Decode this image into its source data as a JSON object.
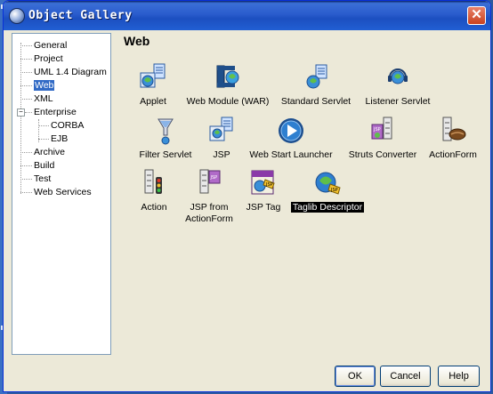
{
  "dialog": {
    "title": "Object Gallery",
    "close_symbol": "✕"
  },
  "tree": {
    "items": [
      {
        "label": "General"
      },
      {
        "label": "Project"
      },
      {
        "label": "UML 1.4 Diagram"
      },
      {
        "label": "Web",
        "selected": true
      },
      {
        "label": "XML"
      },
      {
        "label": "Enterprise",
        "expander": "−"
      },
      {
        "label": "CORBA"
      },
      {
        "label": "EJB"
      },
      {
        "label": "Archive"
      },
      {
        "label": "Build"
      },
      {
        "label": "Test"
      },
      {
        "label": "Web Services"
      }
    ]
  },
  "gallery": {
    "heading": "Web",
    "items": [
      {
        "label": "Applet",
        "icon": "applet-icon"
      },
      {
        "label": "Web Module (WAR)",
        "icon": "web-module-icon"
      },
      {
        "label": "Standard Servlet",
        "icon": "standard-servlet-icon"
      },
      {
        "label": "Listener Servlet",
        "icon": "listener-servlet-icon"
      },
      {
        "label": "Filter Servlet",
        "icon": "filter-servlet-icon"
      },
      {
        "label": "JSP",
        "icon": "jsp-icon"
      },
      {
        "label": "Web Start Launcher",
        "icon": "web-start-launcher-icon"
      },
      {
        "label": "Struts Converter",
        "icon": "struts-converter-icon"
      },
      {
        "label": "ActionForm",
        "icon": "actionform-icon"
      },
      {
        "label": "Action",
        "icon": "action-icon"
      },
      {
        "label": "JSP from",
        "label2": "ActionForm",
        "icon": "jsp-from-actionform-icon"
      },
      {
        "label": "JSP Tag",
        "icon": "jsp-tag-icon"
      },
      {
        "label": "Taglib Descriptor",
        "icon": "taglib-descriptor-icon",
        "selected": true
      }
    ]
  },
  "buttons": {
    "ok": "OK",
    "cancel": "Cancel",
    "help": "Help"
  },
  "colors": {
    "titlebar": "#2a5ccd",
    "selection": "#316ac5",
    "dialog_bg": "#ece9d8"
  }
}
